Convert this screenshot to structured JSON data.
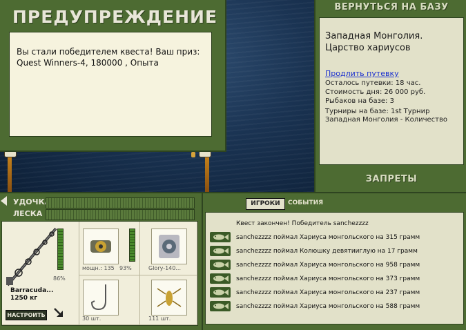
{
  "warning": {
    "title": "ПРЕДУПРЕЖДЕНИЕ",
    "message_line1": "Вы стали победителем квеста! Ваш приз:",
    "message_line2": "Quest Winners-4, 180000 , Опыта"
  },
  "base_panel": {
    "back_label": "ВЕРНУТЬСЯ НА БАЗУ",
    "location_line1": "Западная Монголия.",
    "location_line2": "Царство хариусов",
    "extend_link": "Продлить путевку",
    "time_left": "Осталось путевки: 18 час.",
    "day_cost": "Стоимость дня: 26 000 руб.",
    "anglers": "Рыбаков на базе: 3",
    "tournaments_line1": "Турниры на базе: 1st Турнир",
    "tournaments_line2": "Западная Монголия - Количество",
    "bans_label": "ЗАПРЕТЫ"
  },
  "gear": {
    "rod_label": "УДОЧКА",
    "line_label": "ЛЕСКА",
    "rod_name": "Barracuda...",
    "rod_weight": "1250 кг",
    "rod_percent": "86%",
    "reel_power": "мощн.: 135",
    "reel_percent": "93%",
    "line_name": "Glory-140...",
    "hook_count": "30 шт.",
    "bait_count": "111 шт.",
    "tune_button": "НАСТРОИТЬ",
    "rod_wear_fraction": 0.86,
    "reel_wear_fraction": 0.93
  },
  "events_panel": {
    "tab_games": "ИГРОКИ",
    "tab_events": "СОБЫТИЯ",
    "header": "Квест закончен! Победитель sanchezzzz",
    "items": [
      "sanchezzzz поймал Хариуса монгольского на 315 грамм",
      "sanchezzzz поймал Колюшку девятииглую на 17 грамм",
      "sanchezzzz поймал Хариуса монгольского на 958 грамм",
      "sanchezzzz поймал Хариуса монгольского на 373 грамм",
      "sanchezzzz поймал Хариуса монгольского на 237 грамм",
      "sanchezzzz поймал Хариуса монгольского на 588 грамм"
    ]
  },
  "colors": {
    "panel_green": "#4d6b32",
    "cream": "#f6f3de",
    "link_blue": "#1a2fcf"
  }
}
